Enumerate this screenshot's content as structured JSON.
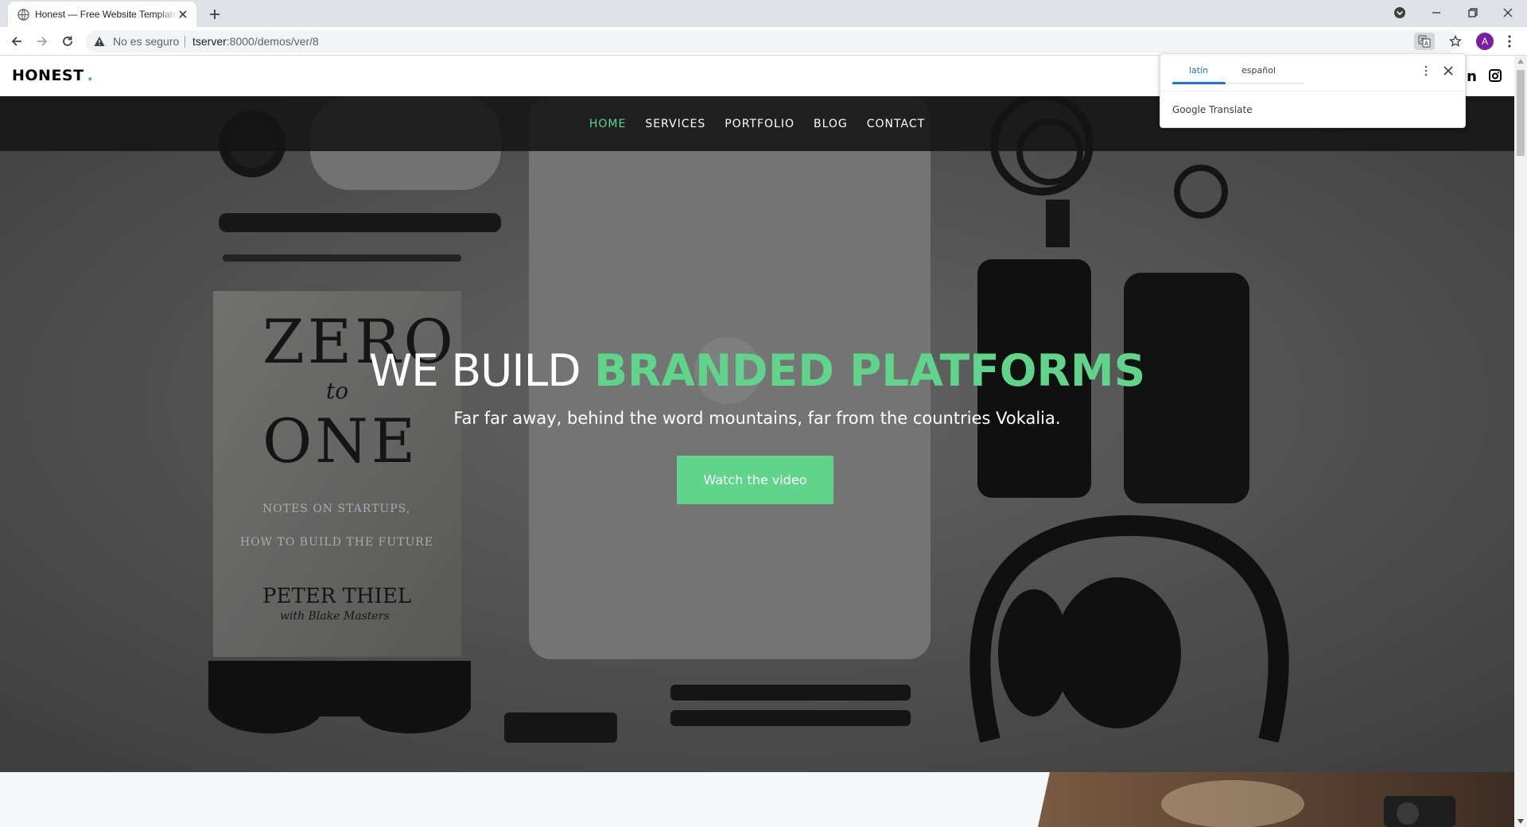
{
  "browser": {
    "tab_title": "Honest — Free Website Template",
    "security_label": "No es seguro",
    "url_host": "tserver",
    "url_rest": ":8000/demos/ver/8",
    "profile_initial": "A"
  },
  "translate": {
    "source_language": "latín",
    "target_language": "español",
    "brand": "Google Translate"
  },
  "site": {
    "logo": "HONEST",
    "logo_dot": ".",
    "social_linkedin": "in",
    "nav": [
      {
        "label": "HOME",
        "active": true
      },
      {
        "label": "SERVICES",
        "active": false
      },
      {
        "label": "PORTFOLIO",
        "active": false
      },
      {
        "label": "BLOG",
        "active": false
      },
      {
        "label": "CONTACT",
        "active": false
      }
    ],
    "hero": {
      "heading_light": "WE BUILD",
      "heading_accent": "BRANDED PLATFORMS",
      "subtitle": "Far far away, behind the word mountains, far from the countries Vokalia.",
      "cta": "Watch the video"
    }
  },
  "colors": {
    "accent": "#5fd48a",
    "nav_bg": "#141414",
    "chrome_bg": "#dee1e6",
    "link_blue": "#1a73e8"
  }
}
